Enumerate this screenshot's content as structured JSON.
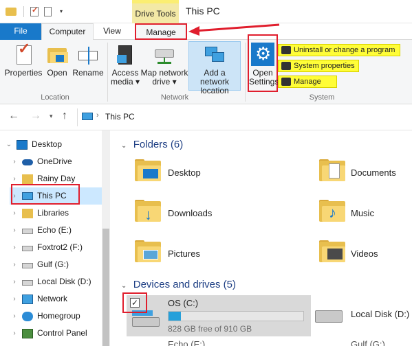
{
  "title_bar": {
    "context_tab": "Drive Tools",
    "window_title": "This PC"
  },
  "tabs": {
    "file": "File",
    "computer": "Computer",
    "view": "View",
    "manage": "Manage"
  },
  "ribbon": {
    "location": {
      "label": "Location",
      "buttons": [
        "Properties",
        "Open",
        "Rename"
      ]
    },
    "network": {
      "label": "Network",
      "access_media": [
        "Access",
        "media"
      ],
      "map_drive": [
        "Map network",
        "drive"
      ],
      "add_location": [
        "Add a network",
        "location"
      ]
    },
    "system": {
      "label": "System",
      "open_settings": [
        "Open",
        "Settings"
      ],
      "uninstall": "Uninstall or change a program",
      "system_properties": "System properties",
      "manage": "Manage"
    }
  },
  "address": {
    "path": "This PC"
  },
  "nav": {
    "items": [
      {
        "label": "Desktop",
        "icon": "desktop-icon",
        "expanded": true
      },
      {
        "label": "OneDrive",
        "icon": "cloud-icon"
      },
      {
        "label": "Rainy Day",
        "icon": "user-folder-icon"
      },
      {
        "label": "This PC",
        "icon": "computer-icon",
        "selected": true
      },
      {
        "label": "Libraries",
        "icon": "library-icon"
      },
      {
        "label": "Echo (E:)",
        "icon": "drive-icon"
      },
      {
        "label": "Foxtrot2 (F:)",
        "icon": "drive-icon"
      },
      {
        "label": "Gulf (G:)",
        "icon": "drive-icon"
      },
      {
        "label": "Local Disk (D:)",
        "icon": "drive-icon"
      },
      {
        "label": "Network",
        "icon": "network-icon"
      },
      {
        "label": "Homegroup",
        "icon": "homegroup-icon"
      },
      {
        "label": "Control Panel",
        "icon": "control-panel-icon"
      }
    ]
  },
  "content": {
    "folders_header": "Folders (6)",
    "folders": [
      "Desktop",
      "Documents",
      "Downloads",
      "Music",
      "Pictures",
      "Videos"
    ],
    "devices_header": "Devices and drives (5)",
    "drive_c": {
      "name": "OS (C:)",
      "free": "828 GB free of 910 GB",
      "used_fraction": 0.09
    },
    "drive_d": {
      "name": "Local Disk (D:)"
    },
    "partial_labels": [
      "Echo (E:)",
      "Gulf (G:)"
    ]
  },
  "colors": {
    "accent": "#1979ca",
    "highlight": "#fffd38",
    "annotation": "#e01e2d",
    "drivetools": "#f3e9a6"
  }
}
